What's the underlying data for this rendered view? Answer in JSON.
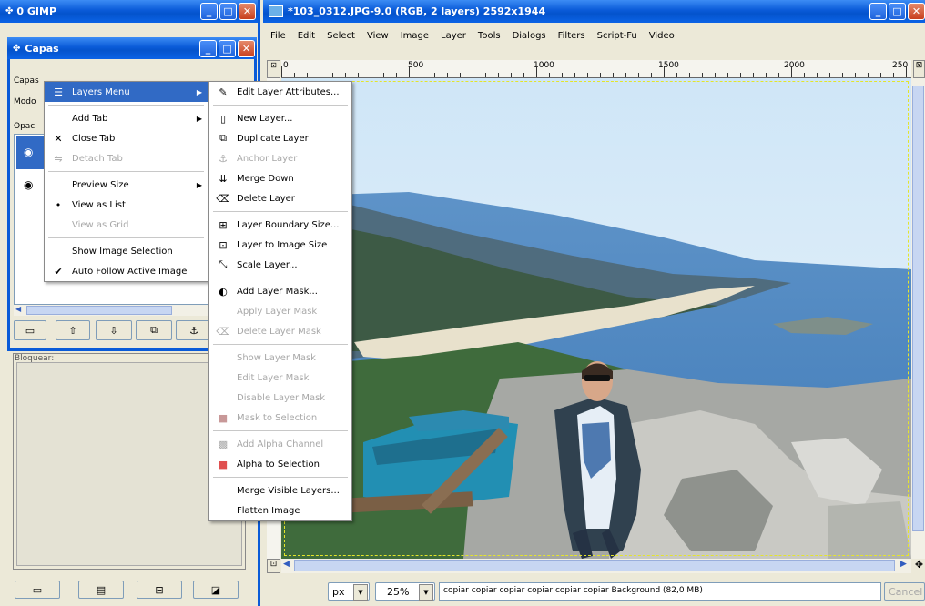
{
  "gimp_main": {
    "title": "0 GIMP"
  },
  "capas_window": {
    "title": "Capas",
    "labels": {
      "capas": "Capas",
      "modo": "Modo",
      "opacidad": "Opaci"
    },
    "under_label": "Bloquear:"
  },
  "context_menu": {
    "items": [
      {
        "label": "Layers Menu",
        "selected": true,
        "submenu": true
      },
      {
        "label": "Add Tab",
        "submenu": true
      },
      {
        "label": "Close Tab",
        "icon": "✕"
      },
      {
        "label": "Detach Tab",
        "disabled": true
      },
      {
        "label": "Preview Size",
        "submenu": true
      },
      {
        "label": "View as List",
        "icon": "•"
      },
      {
        "label": "View as Grid",
        "disabled": true
      },
      {
        "label": "Show Image Selection"
      },
      {
        "label": "Auto Follow Active Image",
        "icon": "✔"
      }
    ]
  },
  "layers_submenu": {
    "items": [
      {
        "label": "Edit Layer Attributes...",
        "icon": "edit-icon"
      },
      {
        "label": "New Layer...",
        "icon": "new-layer-icon"
      },
      {
        "label": "Duplicate Layer",
        "icon": "duplicate-icon"
      },
      {
        "label": "Anchor Layer",
        "icon": "anchor-icon",
        "disabled": true
      },
      {
        "label": "Merge Down",
        "icon": "merge-icon"
      },
      {
        "label": "Delete Layer",
        "icon": "delete-icon"
      },
      {
        "label": "Layer Boundary Size...",
        "icon": "boundary-icon"
      },
      {
        "label": "Layer to Image Size",
        "icon": "to-image-size-icon"
      },
      {
        "label": "Scale Layer...",
        "icon": "scale-icon"
      },
      {
        "label": "Add Layer Mask...",
        "icon": "mask-icon"
      },
      {
        "label": "Apply Layer Mask",
        "disabled": true
      },
      {
        "label": "Delete Layer Mask",
        "icon": "delete-mask-icon",
        "disabled": true
      },
      {
        "label": "Show Layer Mask",
        "disabled": true
      },
      {
        "label": "Edit Layer Mask",
        "disabled": true
      },
      {
        "label": "Disable Layer Mask",
        "disabled": true
      },
      {
        "label": "Mask to Selection",
        "icon": "mask-sel-icon",
        "disabled": true
      },
      {
        "label": "Add Alpha Channel",
        "icon": "alpha-icon",
        "disabled": true
      },
      {
        "label": "Alpha to Selection",
        "icon": "alpha-sel-icon"
      },
      {
        "label": "Merge Visible Layers..."
      },
      {
        "label": "Flatten Image"
      }
    ]
  },
  "image_window": {
    "title": "*103_0312.JPG-9.0 (RGB, 2 layers) 2592x1944",
    "menubar": [
      "File",
      "Edit",
      "Select",
      "View",
      "Image",
      "Layer",
      "Tools",
      "Dialogs",
      "Filters",
      "Script-Fu",
      "Video"
    ],
    "ruler_labels": [
      "0",
      "500",
      "1000",
      "1500",
      "2000",
      "250"
    ],
    "status": {
      "unit": "px",
      "zoom": "25%",
      "message": "copiar copiar copiar copiar copiar copiar Background (82,0 MB)",
      "cancel": "Cancel"
    }
  },
  "colors": {
    "xp_blue": "#0A5BD8",
    "selection": "#316AC5",
    "menu_bg": "#FFFFFF"
  }
}
